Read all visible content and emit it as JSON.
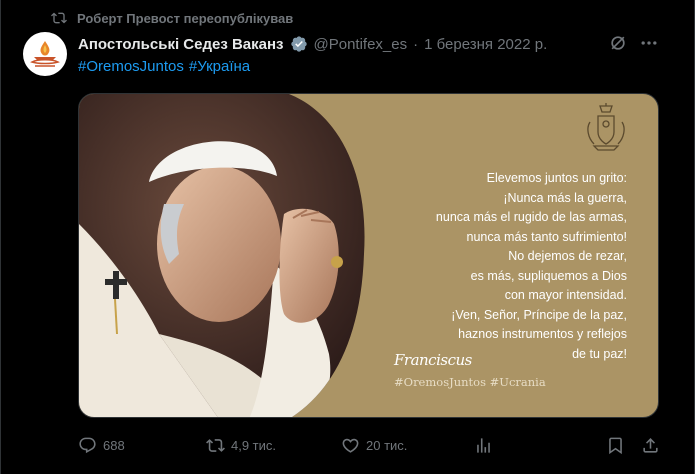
{
  "repost": {
    "text": "Роберт Превост переопублікував"
  },
  "author": {
    "name": "Апостольські Седез Ваканз",
    "handle": "@Pontifex_es",
    "separator": "·",
    "date": "1 березня 2022 р."
  },
  "post": {
    "hashtags": [
      "#OremosJuntos",
      "#Україна"
    ]
  },
  "media": {
    "quote_lines": [
      "Elevemos juntos un grito:",
      "¡Nunca más la guerra,",
      "nunca más el rugido de las armas,",
      "nunca más tanto sufrimiento!",
      "No dejemos de rezar,",
      "es más, supliquemos a Dios",
      "con mayor intensidad.",
      "¡Ven, Señor, Príncipe de la paz,",
      "haznos instrumentos y reflejos",
      "de tu paz!"
    ],
    "signature": "Franciscus",
    "tags": "#OremosJuntos #Ucrania",
    "background_color": "#ab9465"
  },
  "actions": {
    "replies": "688",
    "reposts": "4,9 тис.",
    "likes": "20 тис."
  },
  "colors": {
    "accent": "#1d9bf0",
    "muted": "#71767b",
    "text": "#e7e9ea",
    "background": "#000000"
  },
  "icons": [
    "repost-icon",
    "verified-badge-icon",
    "grok-icon",
    "more-icon",
    "reply-icon",
    "retweet-icon",
    "like-icon",
    "views-icon",
    "bookmark-icon",
    "share-icon"
  ]
}
